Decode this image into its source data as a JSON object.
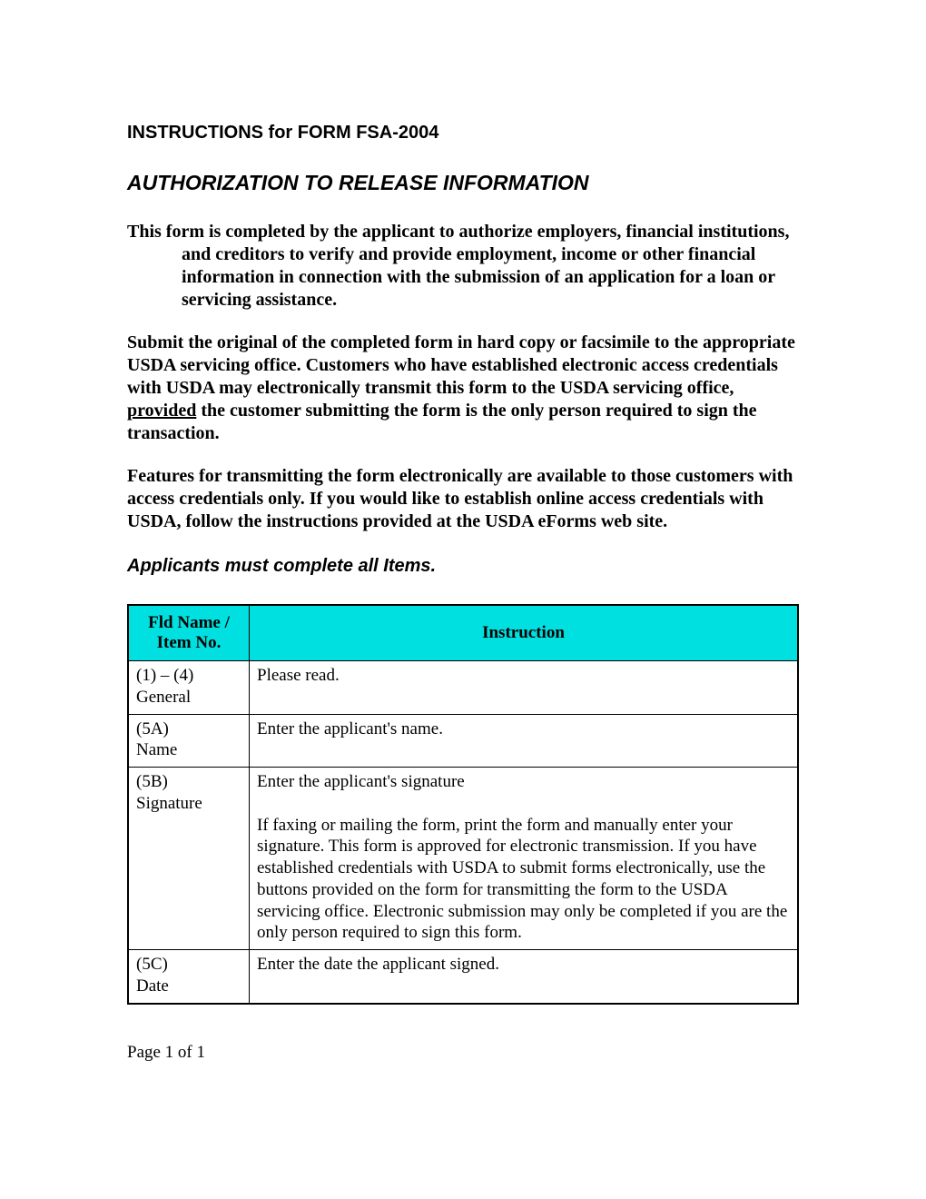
{
  "heading": {
    "instructions_for": "INSTRUCTIONS for FORM FSA-2004",
    "title": "AUTHORIZATION TO RELEASE INFORMATION"
  },
  "paragraphs": {
    "p1": "This form is completed by the applicant to authorize employers, financial institutions, and creditors to verify and provide employment, income or other financial information in connection with the submission of an application for a loan or servicing assistance.",
    "p2a": "Submit the original of the completed form in hard copy or facsimile to the appropriate USDA servicing office.  Customers who have established electronic access credentials with USDA may electronically transmit this form to the USDA servicing office, ",
    "p2_provided": "provided",
    "p2b": " the customer submitting the form is the only person required to sign the transaction.",
    "p3": "Features for transmitting the form electronically are available to those customers with access credentials only.  If you would like to establish online access credentials with USDA, follow the instructions provided at the USDA eForms web site.",
    "must_complete": "Applicants must complete all Items."
  },
  "table": {
    "headers": {
      "col1a": "Fld Name /",
      "col1b": "Item No.",
      "col2": "Instruction"
    },
    "rows": [
      {
        "fld1": "(1) – (4)",
        "fld2": "General",
        "instr": "Please read."
      },
      {
        "fld1": "(5A)",
        "fld2": "Name",
        "instr": "Enter the applicant's name."
      },
      {
        "fld1": "(5B)",
        "fld2": "Signature",
        "instrA": "Enter the applicant's signature",
        "instrB": "If faxing or mailing the form, print the form and manually enter your signature.  This form is approved for electronic transmission.  If you have established credentials with USDA to submit forms electronically, use the buttons provided on the form for transmitting the form to the USDA servicing office.  Electronic submission may only be completed if you are the only person required to sign this form."
      },
      {
        "fld1": "(5C)",
        "fld2": "Date",
        "instr": "Enter the date the applicant signed."
      }
    ]
  },
  "footer": {
    "page": "Page 1 of 1"
  }
}
